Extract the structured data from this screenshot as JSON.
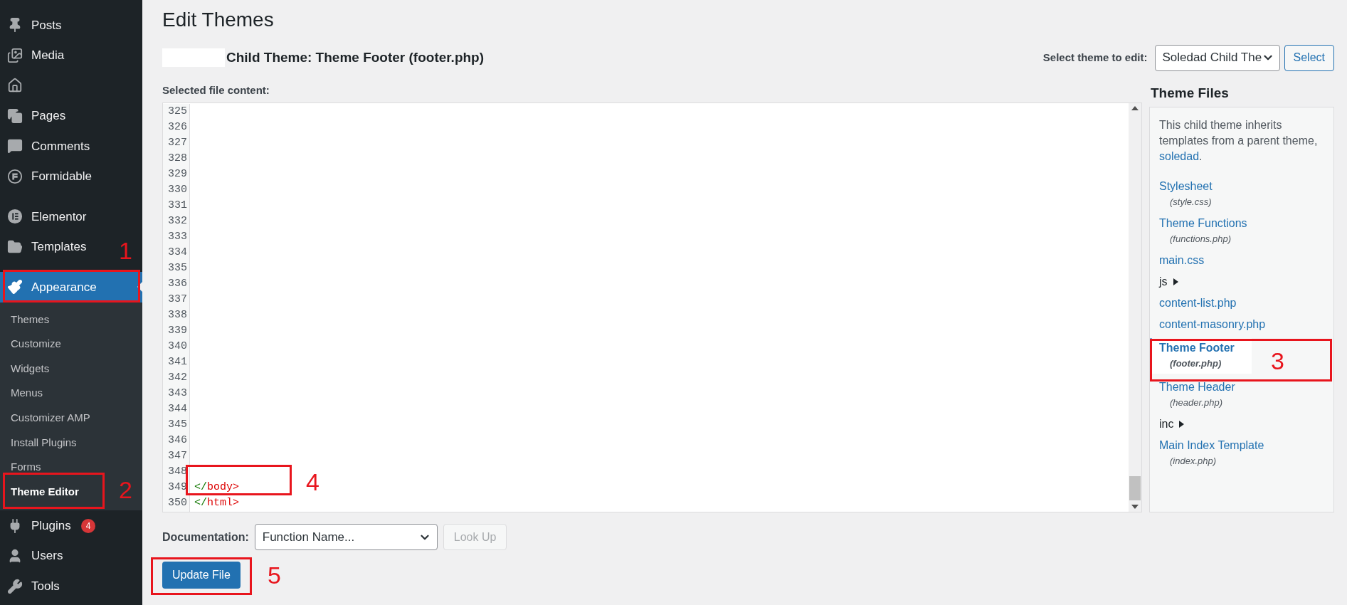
{
  "sidebar": {
    "items": [
      {
        "kind": "menu",
        "label": "Posts",
        "selected": false
      },
      {
        "kind": "menu",
        "label": "Media",
        "selected": false
      },
      {
        "kind": "menu",
        "selected": false
      },
      {
        "kind": "menu",
        "label": "Pages",
        "selected": false
      },
      {
        "kind": "menu",
        "label": "Comments",
        "selected": false
      },
      {
        "kind": "menu",
        "label": "Formidable",
        "selected": false
      },
      {
        "kind": "separator"
      },
      {
        "kind": "menu",
        "label": "Elementor",
        "selected": false
      },
      {
        "kind": "menu",
        "label": "Templates",
        "selected": false
      },
      {
        "kind": "separator"
      },
      {
        "kind": "menu",
        "label": "Appearance",
        "selected": true,
        "children": [
          {
            "label": "Themes",
            "selected": false
          },
          {
            "label": "Customize",
            "selected": false
          },
          {
            "label": "Widgets",
            "selected": false
          },
          {
            "label": "Menus",
            "selected": false
          },
          {
            "label": "Customizer AMP",
            "selected": false
          },
          {
            "label": "Install Plugins",
            "selected": false
          },
          {
            "label": "Forms",
            "selected": false
          },
          {
            "label": "Theme Editor",
            "selected": true
          }
        ]
      },
      {
        "kind": "menu",
        "label": "Plugins",
        "selected": false,
        "badge": "4"
      },
      {
        "kind": "menu",
        "label": "Users",
        "selected": false
      },
      {
        "kind": "menu",
        "label": "Tools",
        "selected": false
      }
    ]
  },
  "page": {
    "title": "Edit Themes",
    "subtitle": "Child Theme: Theme Footer (footer.php)",
    "theme_select_label": "Select theme to edit:",
    "theme_select_value": "Soledad Child The",
    "select_button": "Select",
    "content_label": "Selected file content:"
  },
  "editor": {
    "lines": [
      {
        "number": "325"
      },
      {
        "number": "326"
      },
      {
        "number": "327"
      },
      {
        "number": "328"
      },
      {
        "number": "329"
      },
      {
        "number": "330"
      },
      {
        "number": "331"
      },
      {
        "number": "332"
      },
      {
        "number": "333"
      },
      {
        "number": "334"
      },
      {
        "number": "335"
      },
      {
        "number": "336"
      },
      {
        "number": "337"
      },
      {
        "number": "338"
      },
      {
        "number": "339"
      },
      {
        "number": "340"
      },
      {
        "number": "341"
      },
      {
        "number": "342"
      },
      {
        "number": "343"
      },
      {
        "number": "344"
      },
      {
        "number": "345"
      },
      {
        "number": "346"
      },
      {
        "number": "347"
      },
      {
        "number": "348"
      },
      {
        "number": "349",
        "tokens": [
          {
            "text": "</",
            "kind": "punct"
          },
          {
            "text": "body",
            "kind": "tag"
          },
          {
            "text": ">",
            "kind": "tag"
          }
        ]
      },
      {
        "number": "350",
        "tokens": [
          {
            "text": "</",
            "kind": "punct"
          },
          {
            "text": "html",
            "kind": "tag"
          },
          {
            "text": ">",
            "kind": "tag"
          }
        ]
      }
    ]
  },
  "theme_files": {
    "heading": "Theme Files",
    "note": "This child theme inherits templates from a parent theme,",
    "note_link": "soledad",
    "note_end": ".",
    "files": [
      {
        "kind": "file",
        "label": "Stylesheet",
        "filename": "(style.css)",
        "selected": false
      },
      {
        "kind": "file",
        "label": "Theme Functions",
        "filename": "(functions.php)",
        "selected": false
      },
      {
        "kind": "file",
        "label": "main.css",
        "selected": false
      },
      {
        "kind": "folder",
        "label": "js"
      },
      {
        "kind": "file",
        "label": "content-list.php",
        "selected": false
      },
      {
        "kind": "file",
        "label": "content-masonry.php",
        "selected": false
      },
      {
        "kind": "file",
        "label": "Theme Footer",
        "filename": "(footer.php)",
        "selected": true
      },
      {
        "kind": "file",
        "label": "Theme Header",
        "filename": "(header.php)",
        "selected": false
      },
      {
        "kind": "folder",
        "label": "inc"
      },
      {
        "kind": "file",
        "label": "Main Index Template",
        "filename": "(index.php)",
        "selected": false
      }
    ]
  },
  "documentation": {
    "label": "Documentation:",
    "placeholder": "Function Name...",
    "lookup_button": "Look Up",
    "lookup_disabled": true
  },
  "update_button": "Update File",
  "annotations": [
    {
      "number": "1"
    },
    {
      "number": "2"
    },
    {
      "number": "3"
    },
    {
      "number": "4"
    },
    {
      "number": "5"
    }
  ]
}
